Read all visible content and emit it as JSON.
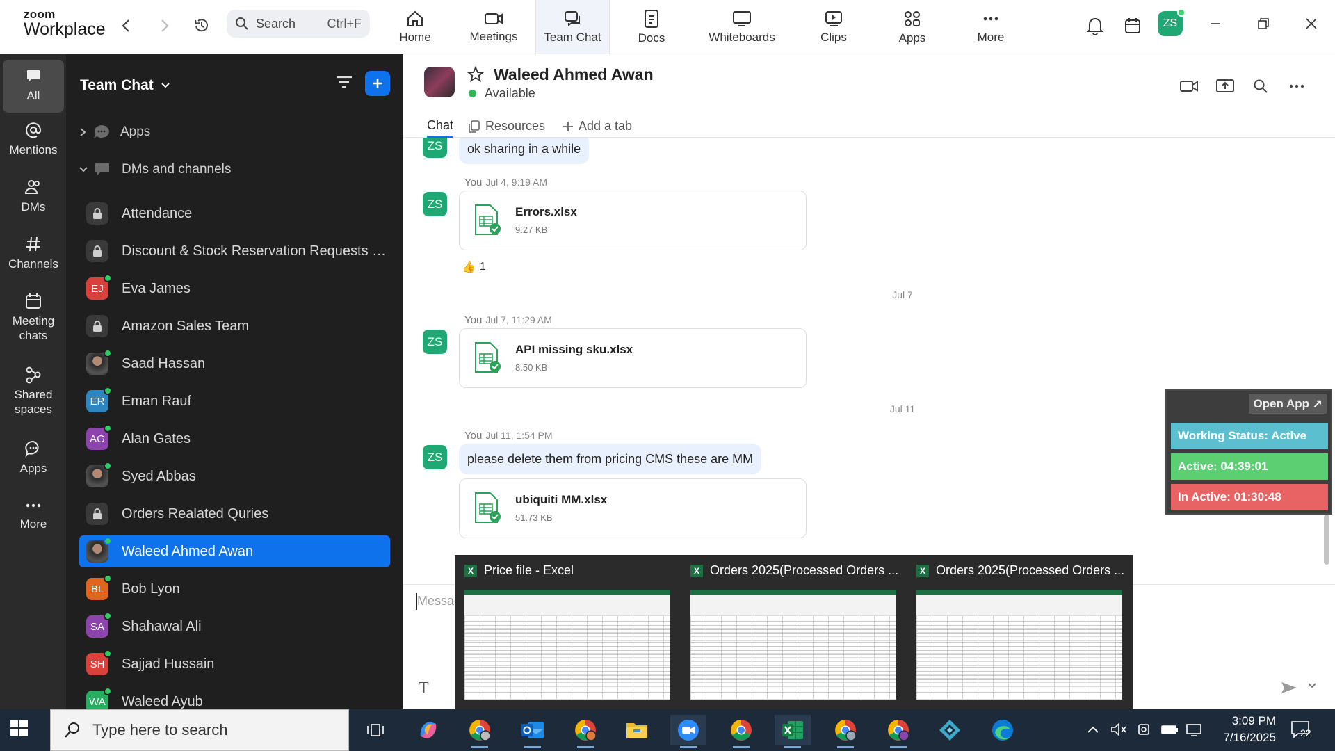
{
  "app": {
    "logo_line1": "zoom",
    "logo_line2": "Workplace",
    "search_placeholder": "Search",
    "search_shortcut": "Ctrl+F",
    "user_initials": "ZS"
  },
  "nav_tabs": [
    {
      "label": "Home",
      "icon": "home-icon"
    },
    {
      "label": "Meetings",
      "icon": "video-camera-icon"
    },
    {
      "label": "Team Chat",
      "icon": "chat-bubbles-icon",
      "active": true
    },
    {
      "label": "Docs",
      "icon": "document-icon"
    },
    {
      "label": "Whiteboards",
      "icon": "whiteboard-icon"
    },
    {
      "label": "Clips",
      "icon": "clips-icon"
    },
    {
      "label": "Apps",
      "icon": "apps-icon"
    },
    {
      "label": "More",
      "icon": "more-dots-icon"
    }
  ],
  "rail": [
    {
      "label": "All",
      "icon": "chat-icon",
      "active": true
    },
    {
      "label": "Mentions",
      "icon": "at-icon"
    },
    {
      "label": "DMs",
      "icon": "people-icon"
    },
    {
      "label": "Channels",
      "icon": "hash-icon"
    },
    {
      "label": "Meeting chats",
      "icon": "calendar-icon"
    },
    {
      "label": "Shared spaces",
      "icon": "shared-spaces-icon"
    },
    {
      "label": "Apps",
      "icon": "apps-chat-icon"
    },
    {
      "label": "More",
      "icon": "more-icon"
    }
  ],
  "sidebar": {
    "title": "Team Chat",
    "sections": {
      "apps": "Apps",
      "dms": "DMs and channels"
    },
    "items": [
      {
        "name": "Attendance",
        "type": "lock"
      },
      {
        "name": "Discount & Stock Reservation Requests O...",
        "type": "lock"
      },
      {
        "name": "Eva James",
        "initials": "EJ",
        "color": "#d9413d",
        "online": true
      },
      {
        "name": "Amazon Sales Team",
        "type": "lock"
      },
      {
        "name": "Saad Hassan",
        "type": "photo",
        "online": true
      },
      {
        "name": "Eman Rauf",
        "initials": "ER",
        "color": "#2e86c1",
        "online": true
      },
      {
        "name": "Alan Gates",
        "initials": "AG",
        "color": "#8e44ad",
        "online": true
      },
      {
        "name": "Syed Abbas",
        "type": "photo",
        "online": true
      },
      {
        "name": "Orders Realated Quries",
        "type": "lock"
      },
      {
        "name": "Waleed Ahmed Awan",
        "type": "photo",
        "online": true,
        "active": true
      },
      {
        "name": "Bob Lyon",
        "initials": "BL",
        "color": "#e0661f",
        "online": true
      },
      {
        "name": "Shahawal Ali",
        "initials": "SA",
        "color": "#8e44ad",
        "online": true
      },
      {
        "name": "Sajjad Hussain",
        "initials": "SH",
        "color": "#d9413d",
        "online": true
      },
      {
        "name": "Waleed Ayub",
        "initials": "WA",
        "color": "#27ae60",
        "online": true
      }
    ]
  },
  "chat": {
    "contact_name": "Waleed Ahmed Awan",
    "status": "Available",
    "tabs": {
      "chat": "Chat",
      "resources": "Resources",
      "add": "Add a tab"
    },
    "messages": {
      "m0_text": "ok sharing in a while",
      "m1_meta_you": "You",
      "m1_meta_time": "Jul 4, 9:19 AM",
      "m1_file": "Errors.xlsx",
      "m1_size": "9.27 KB",
      "m1_reaction_count": "1",
      "sep1": "Jul 7",
      "m2_meta_you": "You",
      "m2_meta_time": "Jul 7, 11:29 AM",
      "m2_file": "API missing sku.xlsx",
      "m2_size": "8.50 KB",
      "sep2": "Jul 11",
      "m3_meta_you": "You",
      "m3_meta_time": "Jul 11, 1:54 PM",
      "m3_text": "please delete them from pricing CMS these are MM",
      "m3_file": "ubiquiti MM.xlsx",
      "m3_size": "51.73 KB",
      "sender_initials": "ZS"
    },
    "composer_placeholder": "Messag"
  },
  "widget": {
    "open_app": "Open App ↗",
    "working_status": "Working Status: Active",
    "active": "Active: 04:39:01",
    "inactive": "In Active: 01:30:48",
    "colors": {
      "working": "#5bbfcf",
      "active": "#5ccf72",
      "inactive": "#e86464"
    }
  },
  "previews": [
    {
      "title": "Price file - Excel"
    },
    {
      "title": "Orders 2025(Processed Orders ..."
    },
    {
      "title": "Orders 2025(Processed Orders ..."
    }
  ],
  "taskbar": {
    "search_placeholder": "Type here to search",
    "time": "3:09 PM",
    "date": "7/16/2025",
    "notifications": "22"
  }
}
